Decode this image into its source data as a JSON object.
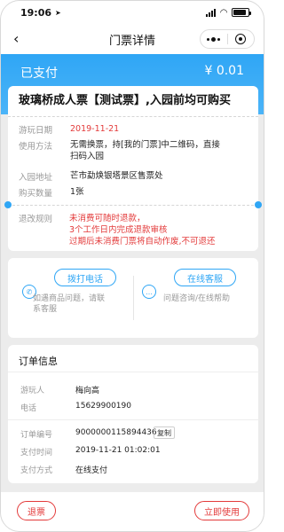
{
  "status_bar": {
    "time": "19:06",
    "battery_level": 0.85
  },
  "nav": {
    "back_icon": "chevron-left-icon",
    "title": "门票详情",
    "more_icon": "more-dots-icon",
    "close_icon": "target-close-icon"
  },
  "header": {
    "status": "已支付",
    "amount": "¥ 0.01",
    "color": "#2fa6f5"
  },
  "ticket": {
    "title": "玻璃桥成人票【测试票】,入园前均可购买",
    "visit_date_label": "游玩日期",
    "visit_date": "2019-11-21",
    "usage_label": "使用方法",
    "usage_line1": "无需换票，持[我的门票]中二维码，直接",
    "usage_line2": "扫码入园",
    "address_label": "入园地址",
    "address": "芒市勐焕银塔景区售票处",
    "quantity_label": "购买数量",
    "quantity": "1张",
    "refund_label": "退改规则",
    "refund_line1": "未消费可随时退款，",
    "refund_line2": "3个工作日内完成退款审核",
    "refund_line3": "过期后未消费门票将自动作废,不可退还"
  },
  "contact": {
    "phone_button": "拨打电话",
    "phone_desc_line1": "如遇商品问题，请联",
    "phone_desc_line2": "系客服",
    "service_button": "在线客服",
    "service_desc": "问题咨询/在线帮助"
  },
  "order": {
    "heading": "订单信息",
    "visitor_label": "游玩人",
    "visitor": "梅向高",
    "phone_label": "电话",
    "phone": "15629900190",
    "order_no_label": "订单编号",
    "order_no": "9000000115894436",
    "copy_label": "复制",
    "pay_time_label": "支付时间",
    "pay_time": "2019-11-21 01:02:01",
    "pay_method_label": "支付方式",
    "pay_method": "在线支付"
  },
  "bottom": {
    "refund_button": "退票",
    "use_button": "立即使用",
    "accent_color": "#e33a3a"
  }
}
